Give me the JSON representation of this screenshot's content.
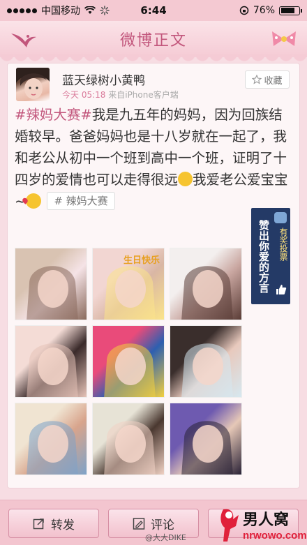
{
  "status_bar": {
    "carrier": "中国移动",
    "time": "6:44",
    "battery": "76%",
    "battery_level": 0.76
  },
  "nav": {
    "title": "微博正文"
  },
  "post": {
    "username": "蓝天绿树小黄鸭",
    "time": "今天 05:18",
    "source": "来自iPhone客户端",
    "favorite_label": "收藏",
    "hashtag": "#辣妈大赛#",
    "text_main": "我是九五年的妈妈，因为回族结婚较早。爸爸妈妈也是十八岁就在一起了，我和老公从初中一个班到高中一个班，证明了十四岁的爱情也可以走得很远",
    "text_after_emoji": "我爱老公爱宝宝~",
    "topic_tag": "# 辣妈大赛"
  },
  "vote_banner": {
    "main_text": "赞出你爱的方言",
    "sub_text": "有奖投票"
  },
  "photos": [
    {
      "name": "photo-1",
      "colors": [
        "#d9c3b2",
        "#f5e3e6",
        "#8a6a5c"
      ],
      "caption": ""
    },
    {
      "name": "photo-2",
      "colors": [
        "#f2d6d2",
        "#d9b6a4",
        "#fbe48a"
      ],
      "caption": "生日快乐"
    },
    {
      "name": "photo-3",
      "colors": [
        "#f3efee",
        "#c9a6a0",
        "#5a3c36"
      ],
      "caption": ""
    },
    {
      "name": "photo-4",
      "colors": [
        "#f4dcd6",
        "#3a2a2a",
        "#e6c3b8"
      ],
      "caption": ""
    },
    {
      "name": "photo-5",
      "colors": [
        "#e94b7a",
        "#2d5fb0",
        "#f3d03e"
      ],
      "caption": ""
    },
    {
      "name": "photo-6",
      "colors": [
        "#3a2e2c",
        "#e8c9bd",
        "#d6e8f0"
      ],
      "caption": ""
    },
    {
      "name": "photo-7",
      "colors": [
        "#f0e4d2",
        "#d8a48c",
        "#7ea3c8"
      ],
      "caption": ""
    },
    {
      "name": "photo-8",
      "colors": [
        "#e7e3d6",
        "#4a3830",
        "#f1d2c4"
      ],
      "caption": ""
    },
    {
      "name": "photo-9",
      "colors": [
        "#6e5ab0",
        "#e6c8b7",
        "#2a2236"
      ],
      "caption": ""
    }
  ],
  "toolbar": {
    "repost_label": "转发",
    "comment_label": "评论"
  },
  "watermark": {
    "weibo_credit": "@大大DIKE",
    "site_name": "男人窝",
    "site_url": "nrwowo.com"
  },
  "colors": {
    "accent": "#c2567c",
    "background": "#f7dde3",
    "banner": "#243a66"
  }
}
